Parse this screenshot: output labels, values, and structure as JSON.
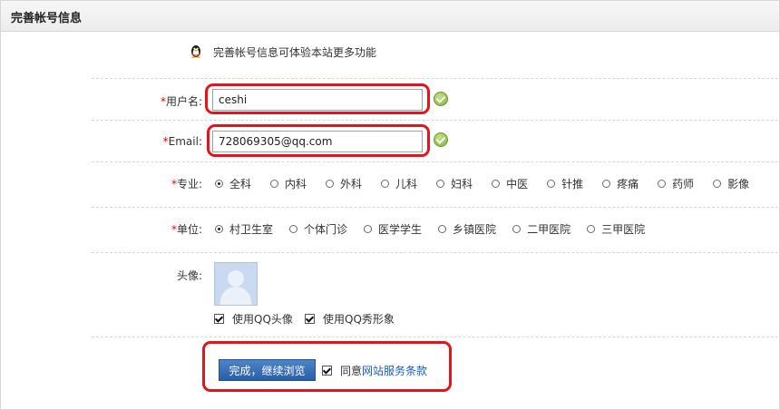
{
  "header": {
    "title": "完善帐号信息"
  },
  "tip": {
    "icon": "qq-penguin-icon",
    "text": "完善帐号信息可体验本站更多功能"
  },
  "fields": {
    "username": {
      "required_mark": "*",
      "label": "用户名:",
      "value": "ceshi",
      "status_icon": "check-icon"
    },
    "email": {
      "required_mark": "*",
      "label": "Email:",
      "value": "728069305@qq.com",
      "status_icon": "check-icon"
    }
  },
  "major": {
    "required_mark": "*",
    "label": "专业:",
    "options": [
      "全科",
      "内科",
      "外科",
      "儿科",
      "妇科",
      "中医",
      "针推",
      "疼痛",
      "药师",
      "影像"
    ],
    "selected": "全科"
  },
  "unit": {
    "required_mark": "*",
    "label": "单位:",
    "options": [
      "村卫生室",
      "个体门诊",
      "医学学生",
      "乡镇医院",
      "二甲医院",
      "三甲医院"
    ],
    "selected": "村卫生室"
  },
  "avatar": {
    "label": "头像:",
    "use_qq_avatar": {
      "label": "使用QQ头像",
      "checked": true
    },
    "use_qq_show": {
      "label": "使用QQ秀形象",
      "checked": true
    }
  },
  "submit": {
    "button_label": "完成，继续浏览",
    "agree": {
      "checked": true,
      "prefix": "同意",
      "link_text": "网站服务条款"
    }
  },
  "colors": {
    "highlight_red": "#e5141b",
    "button_blue": "#2a5ea8",
    "link_blue": "#1a5fb4",
    "required_red": "#e00"
  }
}
